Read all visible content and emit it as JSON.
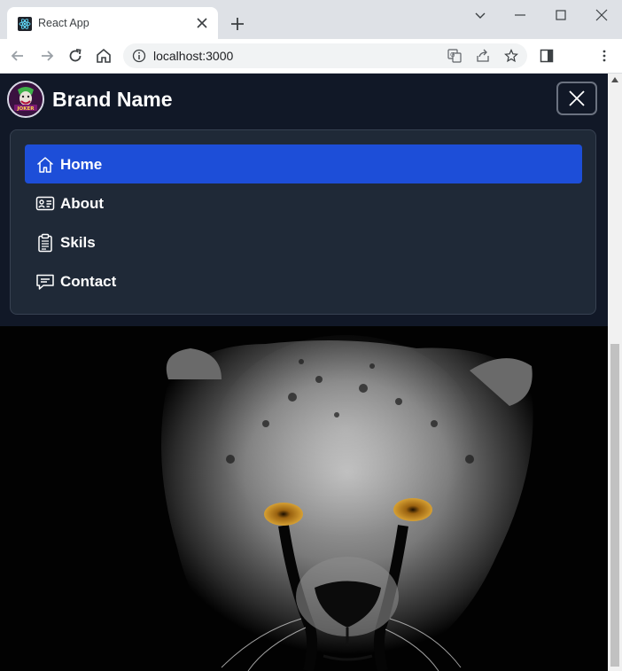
{
  "browser": {
    "tab_title": "React App",
    "url": "localhost:3000"
  },
  "navbar": {
    "brand": "Brand Name",
    "logo_text": "JOKER",
    "menu": [
      {
        "label": "Home",
        "icon": "home-icon",
        "active": true
      },
      {
        "label": "About",
        "icon": "id-card-icon",
        "active": false
      },
      {
        "label": "Skils",
        "icon": "clipboard-icon",
        "active": false
      },
      {
        "label": "Contact",
        "icon": "chat-icon",
        "active": false
      }
    ]
  },
  "colors": {
    "navbar_bg": "#111827",
    "menu_bg": "#1f2937",
    "active": "#1d4ed8"
  }
}
